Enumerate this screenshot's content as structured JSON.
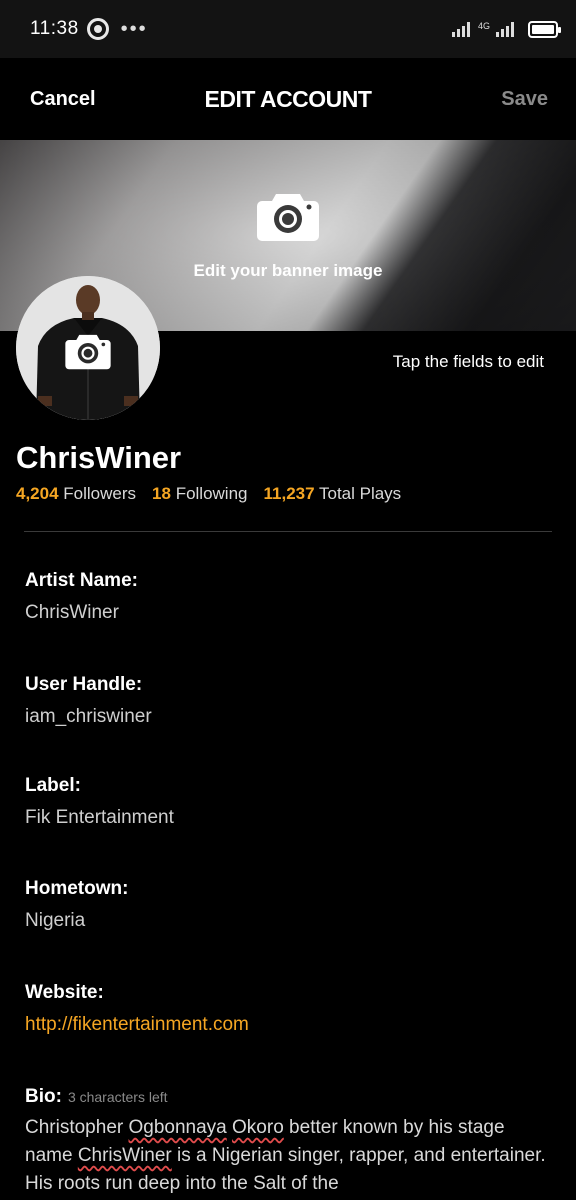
{
  "status_bar": {
    "time": "11:38",
    "dots": "•••",
    "network_label": "4G"
  },
  "nav": {
    "cancel_label": "Cancel",
    "title": "EDIT ACCOUNT",
    "save_label": "Save"
  },
  "banner": {
    "edit_label": "Edit your banner image"
  },
  "hint": "Tap the fields to edit",
  "profile": {
    "name": "ChrisWiner",
    "followers_count": "4,204",
    "followers_label": "Followers",
    "following_count": "18",
    "following_label": "Following",
    "plays_count": "11,237",
    "plays_label": "Total Plays"
  },
  "fields": {
    "artist_name": {
      "label": "Artist Name:",
      "value": "ChrisWiner"
    },
    "user_handle": {
      "label": "User Handle:",
      "value": "iam_chriswiner"
    },
    "label": {
      "label": "Label:",
      "value": "Fik Entertainment"
    },
    "hometown": {
      "label": "Hometown:",
      "value": "Nigeria"
    },
    "website": {
      "label": "Website:",
      "value": "http://fikentertainment.com"
    },
    "bio": {
      "label": "Bio:",
      "counter": "3 characters left",
      "text_1": "Christopher ",
      "word_1": "Ogbonnaya",
      "text_2": " ",
      "word_2": "Okoro",
      "text_3": " better known by his stage name ",
      "word_3": "ChrisWiner",
      "text_4": " is a Nigerian singer, rapper, and entertainer. His roots run deep into the Salt of the"
    }
  },
  "colors": {
    "accent": "#f5a623",
    "background": "#000000",
    "disabled": "#8a8a8a"
  }
}
